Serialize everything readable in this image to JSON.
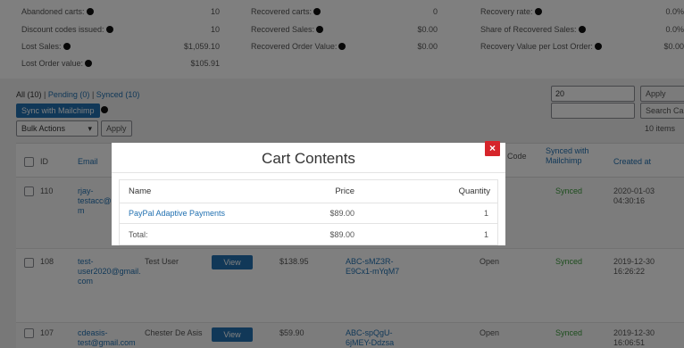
{
  "stats": {
    "rows": [
      [
        {
          "label": "Abandoned carts:",
          "value": "10"
        },
        {
          "label": "Recovered carts:",
          "value": "0"
        },
        {
          "label": "Recovery rate:",
          "value": "0.0%"
        }
      ],
      [
        {
          "label": "Discount codes issued:",
          "value": "10"
        },
        {
          "label": "Recovered Sales:",
          "value": "$0.00"
        },
        {
          "label": "Share of Recovered Sales:",
          "value": "0.0%"
        }
      ],
      [
        {
          "label": "Lost Sales:",
          "value": "$1,059.10"
        },
        {
          "label": "Recovered Order Value:",
          "value": "$0.00"
        },
        {
          "label": "Recovery Value per Lost Order:",
          "value": "$0.00"
        }
      ],
      [
        {
          "label": "Lost Order value:",
          "value": "$105.91"
        }
      ]
    ]
  },
  "filters": {
    "all": "All (10)",
    "separator": "|",
    "pending": "Pending (0)",
    "synced": "Synced (10)"
  },
  "toolbar": {
    "sync_label": "Sync with Mailchimp",
    "bulk_actions": "Bulk Actions",
    "apply_label": "Apply",
    "per_page_value": "20",
    "per_page_apply": "Apply",
    "search_value": "",
    "search_button": "Search Cart",
    "items_count": "10 items"
  },
  "table": {
    "headers": {
      "id": "ID",
      "email": "Email",
      "coupon_tail": "t Code",
      "synced_with": "Synced with",
      "synced_with_2": "Mailchimp",
      "created_at": "Created at"
    },
    "rows": [
      {
        "id": "110",
        "email": [
          "rjay-",
          "testacc@g",
          "m"
        ],
        "name": "",
        "total": "",
        "coupon": [
          "",
          ""
        ],
        "status": "",
        "synced": "Synced",
        "created": [
          "2020-01-03",
          "04:30:16"
        ]
      },
      {
        "id": "108",
        "email": [
          "test-",
          "user2020@gmail.",
          "com"
        ],
        "name": "Test User",
        "view": "View",
        "total": "$138.95",
        "coupon": [
          "ABC-sMZ3R-",
          "E9Cx1-mYqM7"
        ],
        "status": "Open",
        "synced": "Synced",
        "created": [
          "2019-12-30",
          "16:26:22"
        ]
      },
      {
        "id": "107",
        "email": [
          "cdeasis-",
          "test@gmail.com"
        ],
        "name": "Chester De Asis",
        "view": "View",
        "total": "$59.90",
        "coupon": [
          "ABC-spQgU-",
          "6jMEY-Ddzsa"
        ],
        "status": "Open",
        "synced": "Synced",
        "created": [
          "2019-12-30",
          "16:06:51"
        ]
      }
    ]
  },
  "modal": {
    "title": "Cart Contents",
    "close": "×",
    "headers": {
      "name": "Name",
      "price": "Price",
      "quantity": "Quantity"
    },
    "items": [
      {
        "name": "PayPal Adaptive Payments",
        "price": "$89.00",
        "quantity": "1"
      }
    ],
    "total_label": "Total:",
    "total_price": "$89.00",
    "total_quantity": "1"
  }
}
